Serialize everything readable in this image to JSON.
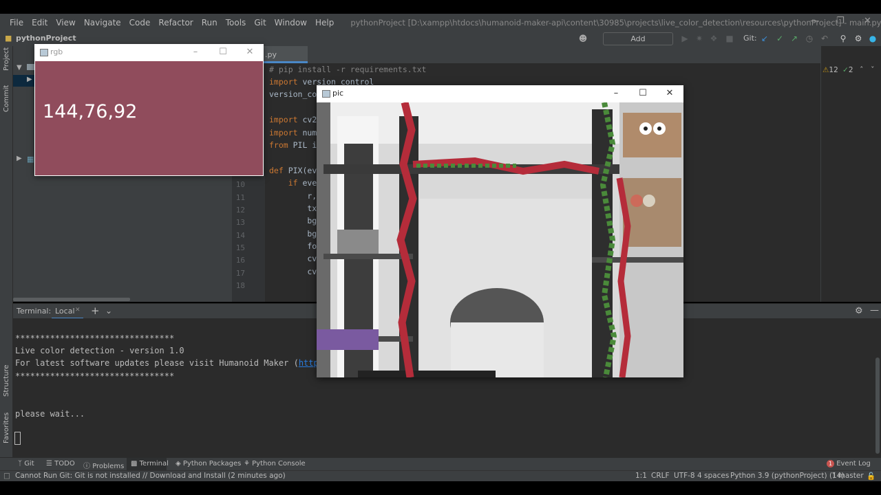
{
  "menubar": {
    "items": [
      "File",
      "Edit",
      "View",
      "Navigate",
      "Code",
      "Refactor",
      "Run",
      "Tools",
      "Git",
      "Window",
      "Help"
    ],
    "title": "pythonProject [D:\\xampp\\htdocs\\humanoid-maker-api\\content\\30985\\projects\\live_color_detection\\resources\\pythonProject] - main.py"
  },
  "navbar": {
    "project": "pythonProject",
    "add_configuration": "Add Configuration...",
    "git_label": "Git:"
  },
  "side_labels": {
    "project": "Project",
    "commit": "Commit",
    "structure": "Structure",
    "favorites": "Favorites"
  },
  "editor": {
    "tab_name": ".py",
    "inspections": {
      "warnings": "12",
      "weak": "2"
    },
    "line_numbers": [
      "10",
      "11",
      "12",
      "13",
      "14",
      "15",
      "16",
      "17",
      "18"
    ],
    "lines": [
      {
        "text": "# pip install -r requirements.txt",
        "cls": "cm"
      },
      {
        "kw": "import",
        "text": " version_control"
      },
      {
        "text": "version_co"
      },
      {
        "text": ""
      },
      {
        "kw": "import",
        "text": " cv2"
      },
      {
        "kw": "import",
        "text": " num"
      },
      {
        "kw": "from",
        "text": " PIL i"
      },
      {
        "text": ""
      },
      {
        "kw": "def",
        "text": " PIX(ev"
      },
      {
        "kw": "    if",
        "text": " eve"
      },
      {
        "text": "        r,"
      },
      {
        "text": "        tx"
      },
      {
        "text": "        bg"
      },
      {
        "text": "        bg"
      },
      {
        "text": "        fo"
      },
      {
        "text": "        cv"
      },
      {
        "text": "        cv"
      },
      {
        "text": ""
      }
    ]
  },
  "terminal": {
    "label": "Terminal:",
    "tab": "Local",
    "lines": [
      "********************************",
      "Live color detection - version 1.0",
      "For latest software updates please visit Humanoid Maker (",
      "********************************",
      "",
      "",
      "please wait..."
    ],
    "link": "https://h"
  },
  "bottom_tabs": [
    "Git",
    "TODO",
    "Problems",
    "Terminal",
    "Python Packages",
    "Python Console"
  ],
  "event_log": "Event Log",
  "event_count": "1",
  "status": {
    "message": "Cannot Run Git: Git is not installed // Download and Install (2 minutes ago)",
    "position": "1:1",
    "line_sep": "CRLF",
    "encoding": "UTF-8",
    "indent": "4 spaces",
    "interpreter": "Python 3.9 (pythonProject) (14)",
    "branch": "master"
  },
  "rgb_window": {
    "title": "rgb",
    "value_text": "144,76,92",
    "color": "#904c5c"
  },
  "pic_window": {
    "title": "pic"
  }
}
